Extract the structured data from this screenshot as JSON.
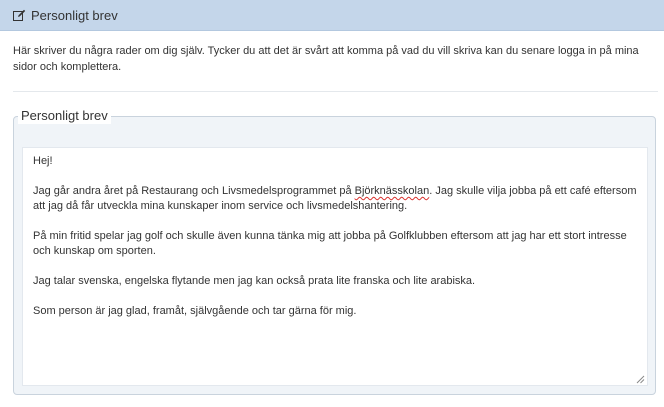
{
  "header": {
    "icon": "edit-icon",
    "title": "Personligt brev"
  },
  "intro": {
    "text": "Här skriver du några rader om dig själv. Tycker du att det är svårt att komma på vad du vill skriva kan du senare logga in på mina sidor och komplettera."
  },
  "letter": {
    "legend": "Personligt brev",
    "greeting": "Hej!",
    "p1_before": "Jag går andra året på Restaurang och Livsmedelsprogrammet på ",
    "p1_misspelled": "Björknässkolan",
    "p1_after": ". Jag skulle vilja jobba på ett café eftersom att jag då får utveckla mina kunskaper inom service och livsmedelshantering.",
    "p2": "På min fritid spelar jag golf och skulle även kunna tänka mig att jobba på Golfklubben eftersom att jag har ett stort intresse och kunskap om sporten.",
    "p3": "Jag talar svenska, engelska flytande men jag kan också prata lite franska och lite arabiska.",
    "p4": "Som person är jag glad, framåt, självgående och tar gärna för mig.",
    "resize_icon": "resize-handle-icon"
  },
  "colors": {
    "header_bg": "#c4d6ea",
    "fieldset_bg": "#f0f4f8",
    "spellcheck": "#d9302c"
  }
}
